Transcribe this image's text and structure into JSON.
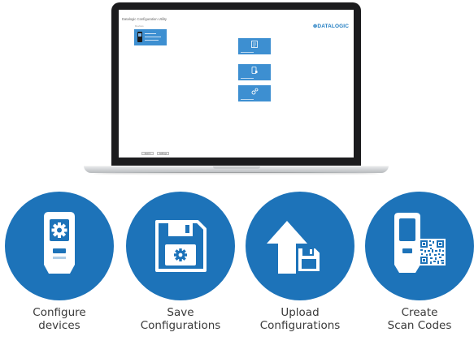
{
  "app": {
    "window_title": "Datalogic Configuration Utility",
    "logo": "⊛DATALOGIC",
    "devices_label": "Devices",
    "buttons": [
      "Search",
      "Settings"
    ]
  },
  "features": [
    {
      "line1": "Configure",
      "line2": "devices",
      "icon": "device-gear-icon"
    },
    {
      "line1": "Save",
      "line2": "Configurations",
      "icon": "floppy-disk-icon"
    },
    {
      "line1": "Upload",
      "line2": "Configurations",
      "icon": "upload-arrow-icon"
    },
    {
      "line1": "Create",
      "line2": "Scan Codes",
      "icon": "qr-code-icon"
    }
  ],
  "colors": {
    "brand_blue": "#1d73b9",
    "tile_blue": "#3d8fd1",
    "label_text": "#3a3a3a"
  }
}
